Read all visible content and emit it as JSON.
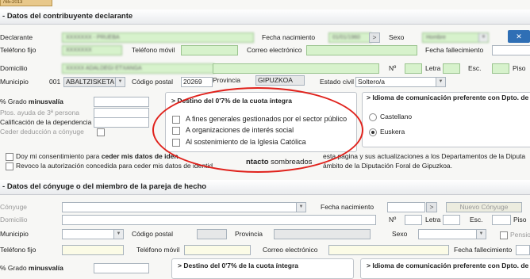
{
  "tab_label": "765-2013",
  "declarant_section": {
    "title": "Datos del contribuyente declarante",
    "declarante_label": "Declarante",
    "declarante_value": "XXXXXXX - PRUEBA",
    "fecha_nacimiento_label": "Fecha nacimiento",
    "fecha_nacimiento_value": "01/01/1960",
    "fecha_nacimiento_btn": ">",
    "sexo_label": "Sexo",
    "sexo_value": "Hombre",
    "telefono_fijo_label": "Teléfono fijo",
    "telefono_fijo_value": "XXXXXXX",
    "telefono_movil_label": "Teléfono móvil",
    "correo_label": "Correo electrónico",
    "fecha_fallecimiento_label": "Fecha fallecimiento",
    "domicilio_label": "Domicilio",
    "domicilio_value": "XXXXX ADALDEGI ETXANGA",
    "numero_label": "Nº",
    "letra_label": "Letra",
    "escalera_label": "Esc.",
    "piso_label": "Piso",
    "municipio_label": "Municipio",
    "municipio_code": "001",
    "municipio_value": "ABALTZISKETA",
    "codigo_postal_label": "Código postal",
    "codigo_postal_value": "20269",
    "provincia_label": "Provincia",
    "provincia_value": "GIPUZKOA",
    "estado_civil_label": "Estado civil",
    "estado_civil_value": "Soltero/a",
    "disability": {
      "grado_label": "% Grado",
      "grado_bold": "minusvalía",
      "ayuda_label": "Ptos. ayuda de 3ª persona",
      "calificacion_label": "Calificación de la dependencia",
      "ceder_label": "Ceder deducción a cónyuge"
    },
    "destino": {
      "title": "Destino del 0'7% de la cuota íntegra",
      "options": [
        "A fines generales gestionados por el sector público",
        "A organizaciones de interés social",
        "Al sostenimiento de la Iglesia Católica"
      ]
    },
    "idioma": {
      "title": "Idioma de comunicación preferente con Dpto. de",
      "options": [
        "Castellano",
        "Euskera"
      ],
      "selected": "Euskera"
    },
    "consent_1_a": "Doy mi consentimiento para",
    "consent_1_bold": "ceder mis datos de iden",
    "consent_1_b": "esta página y sus actualizaciones a los Departamentos de la Diputa",
    "consent_2_a": "Revoco la autorización concedida para ceder mis datos de identid",
    "consent_2_b": "ámbito de la Diputación Foral de Gipuzkoa.",
    "contacto_overlay": "ntacto",
    "contacto_overlay_b": "sombreados"
  },
  "spouse_section": {
    "title": "Datos del cónyuge o del miembro de la pareja de hecho",
    "conyuge_label": "Cónyuge",
    "fecha_nacimiento_label": "Fecha nacimiento",
    "fecha_btn": ">",
    "nuevo_conyuge_btn": "Nuevo Cónyuge",
    "domicilio_label": "Domicilio",
    "numero_label": "Nº",
    "letra_label": "Letra",
    "escalera_label": "Esc.",
    "piso_label": "Piso",
    "municipio_label": "Municipio",
    "codigo_postal_label": "Código postal",
    "provincia_label": "Provincia",
    "sexo_label": "Sexo",
    "pension_label": "Pensio",
    "telefono_fijo_label": "Teléfono fijo",
    "telefono_movil_label": "Teléfono móvil",
    "correo_label": "Correo electrónico",
    "fecha_fallecimiento_label": "Fecha fallecimiento",
    "grado_label": "% Grado",
    "grado_bold": "minusvalía",
    "destino_title": "Destino del 0'7% de la cuota íntegra",
    "idioma_title": "Idioma de comunicación preferente con Dpto. de"
  }
}
